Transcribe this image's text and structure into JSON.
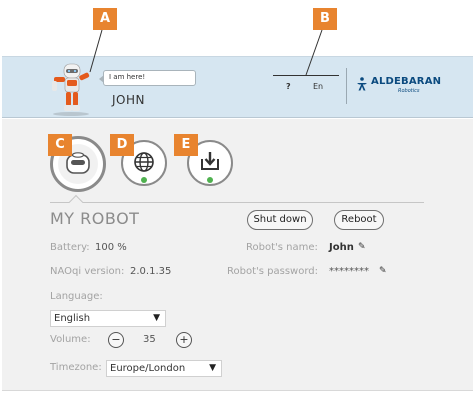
{
  "header": {
    "bubble_text": "I am here!",
    "robot_name": "JOHN",
    "help_label": "?",
    "language_label": "En",
    "brand_name": "ALDEBARAN",
    "brand_sub": "Robotics",
    "background_color": "#d6e6f1"
  },
  "callouts": {
    "a": "A",
    "b": "B",
    "c": "C",
    "d": "D",
    "e": "E",
    "color": "#e8842f"
  },
  "tiles": [
    {
      "name": "my-robot",
      "icon": "robot-head-icon",
      "selected": true
    },
    {
      "name": "network",
      "icon": "globe-icon",
      "status": "online"
    },
    {
      "name": "update",
      "icon": "download-icon",
      "status": "online"
    }
  ],
  "main": {
    "section_title": "MY ROBOT",
    "shutdown_label": "Shut down",
    "reboot_label": "Reboot",
    "battery_label": "Battery:",
    "battery_value": "100 %",
    "naoqi_label": "NAOqi version:",
    "naoqi_value": "2.0.1.35",
    "robot_name_label": "Robot's name:",
    "robot_name_value": "John",
    "robot_password_label": "Robot's password:",
    "robot_password_value": "********",
    "language_label": "Language:",
    "language_value": "English",
    "volume_label": "Volume:",
    "volume_minus": "−",
    "volume_value": "35",
    "volume_plus": "+",
    "timezone_label": "Timezone:",
    "timezone_value": "Europe/London",
    "status_color": "#4fb14f"
  }
}
